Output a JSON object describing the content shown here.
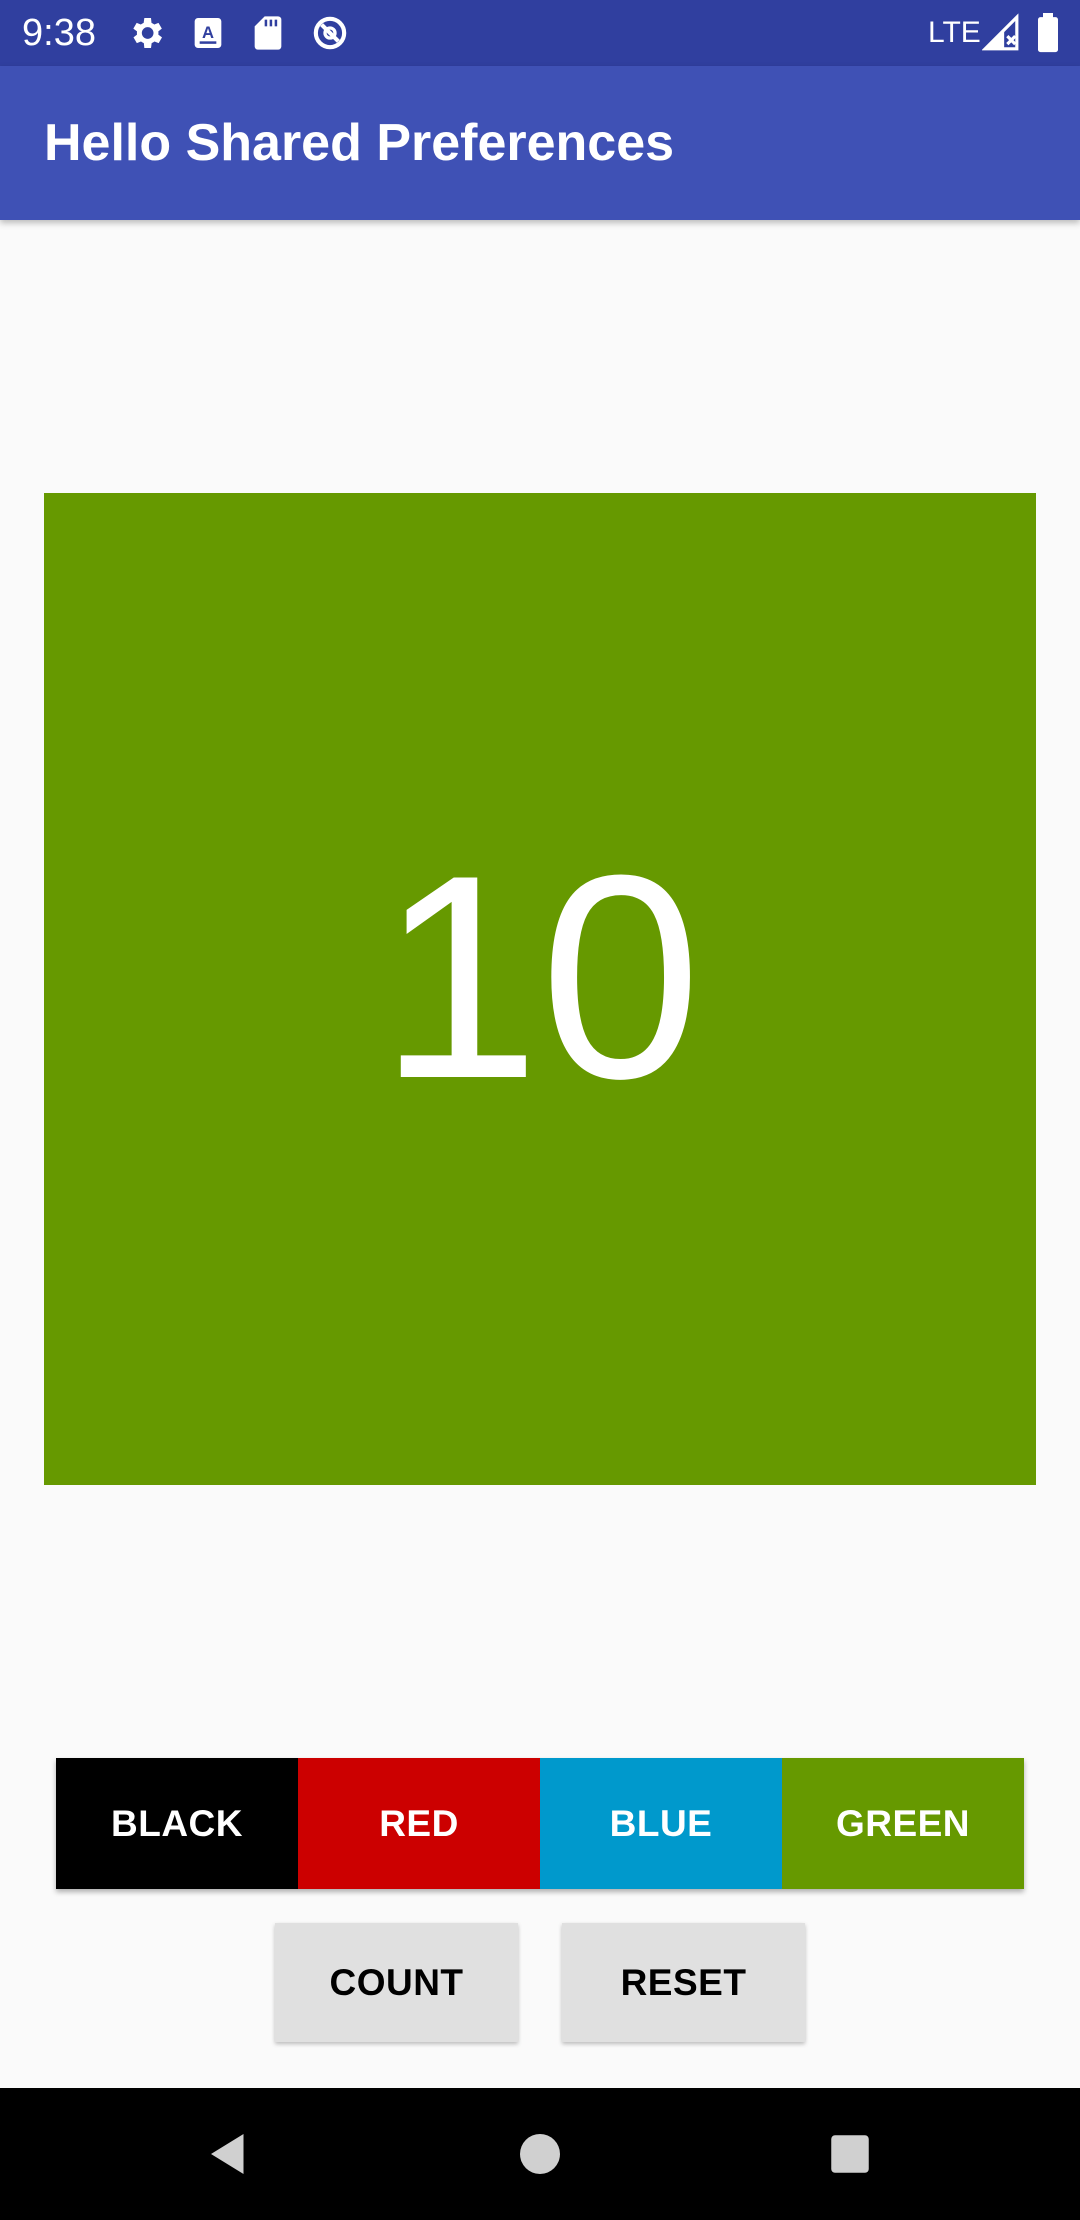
{
  "status_bar": {
    "time": "9:38",
    "network": "LTE",
    "icons": [
      "gear-icon",
      "keyboard-icon",
      "sd-card-icon",
      "sync-icon",
      "signal-icon",
      "battery-icon"
    ]
  },
  "app_bar": {
    "title": "Hello Shared Preferences"
  },
  "counter": {
    "value": "10",
    "background_color": "#669900"
  },
  "color_buttons": [
    {
      "label": "BLACK",
      "color": "#000000"
    },
    {
      "label": "RED",
      "color": "#cc0000"
    },
    {
      "label": "BLUE",
      "color": "#0099cc"
    },
    {
      "label": "GREEN",
      "color": "#669900"
    }
  ],
  "actions": {
    "count_label": "COUNT",
    "reset_label": "RESET"
  },
  "nav_bar": {
    "icons": [
      "back-icon",
      "home-icon",
      "recents-icon"
    ]
  }
}
